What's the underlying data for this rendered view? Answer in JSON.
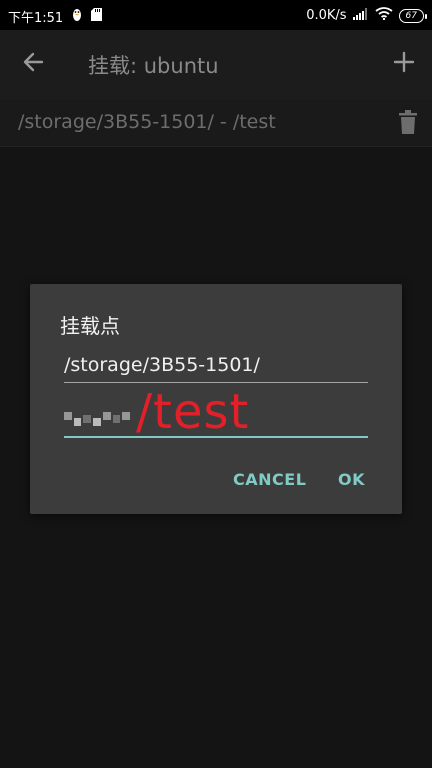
{
  "status_bar": {
    "time": "下午1:51",
    "net_speed": "0.0K/s",
    "battery": "67"
  },
  "toolbar": {
    "title": "挂载: ubuntu"
  },
  "mount_list": {
    "items": [
      {
        "label": "/storage/3B55-1501/ - /test"
      }
    ]
  },
  "dialog": {
    "title": "挂载点",
    "source_value": "/storage/3B55-1501/",
    "target_value": "/test",
    "cancel_label": "CANCEL",
    "ok_label": "OK"
  },
  "colors": {
    "accent": "#80cbc4",
    "annotation_red": "#e3202a",
    "dialog_bg": "#3c3c3c"
  }
}
